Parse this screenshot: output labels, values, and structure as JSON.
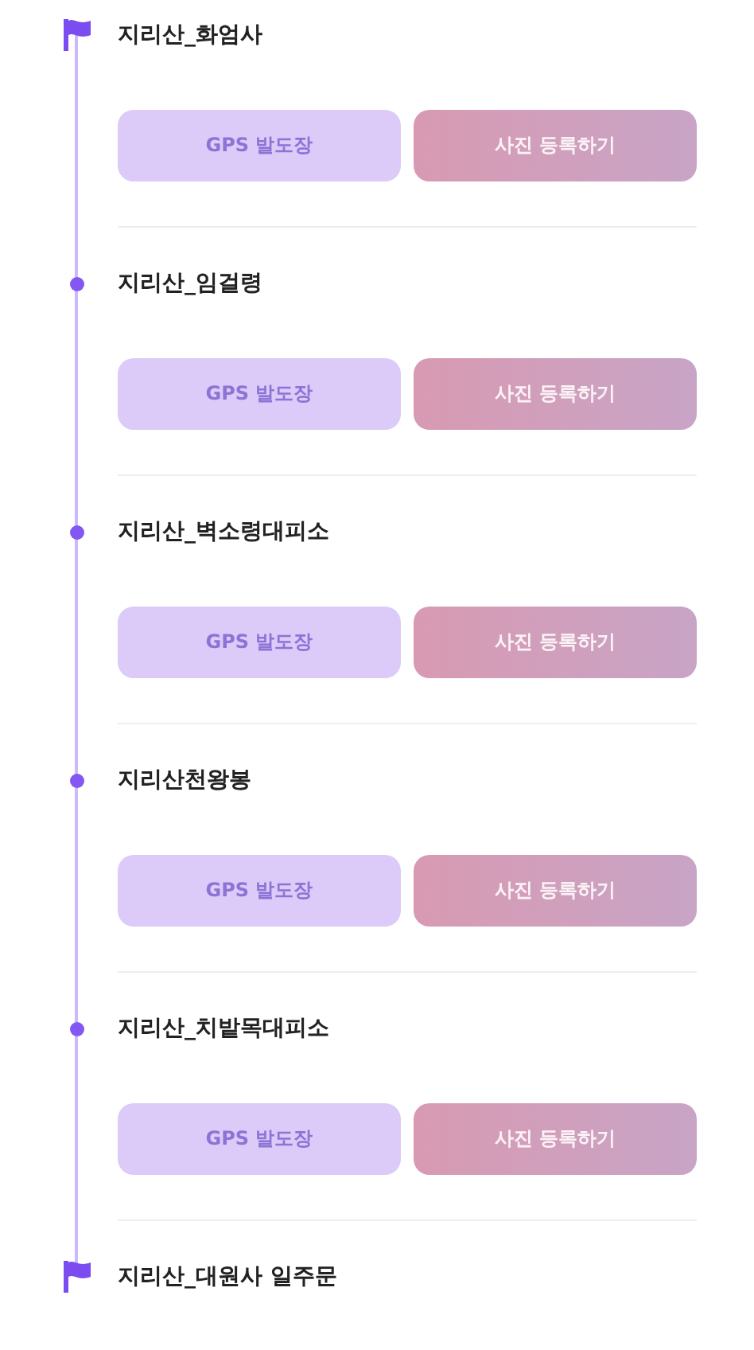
{
  "stops": [
    {
      "name": "지리산_화엄사",
      "kind": "flag",
      "buttons": [
        {
          "kind": "gps",
          "label": "GPS 발도장"
        },
        {
          "kind": "photo",
          "label": "사진 등록하기"
        }
      ]
    },
    {
      "name": "지리산_임걸령",
      "kind": "dot",
      "buttons": [
        {
          "kind": "gps",
          "label": "GPS 발도장"
        },
        {
          "kind": "photo",
          "label": "사진 등록하기"
        }
      ]
    },
    {
      "name": "지리산_벽소령대피소",
      "kind": "dot",
      "buttons": [
        {
          "kind": "gps",
          "label": "GPS 발도장"
        },
        {
          "kind": "photo",
          "label": "사진 등록하기"
        }
      ]
    },
    {
      "name": "지리산천왕봉",
      "kind": "dot",
      "buttons": [
        {
          "kind": "gps",
          "label": "GPS 발도장"
        },
        {
          "kind": "photo",
          "label": "사진 등록하기"
        }
      ]
    },
    {
      "name": "지리산_치밭목대피소",
      "kind": "dot",
      "buttons": [
        {
          "kind": "gps",
          "label": "GPS 발도장"
        },
        {
          "kind": "photo",
          "label": "사진 등록하기"
        }
      ]
    },
    {
      "name": "지리산_대원사 일주문",
      "kind": "flag"
    }
  ]
}
